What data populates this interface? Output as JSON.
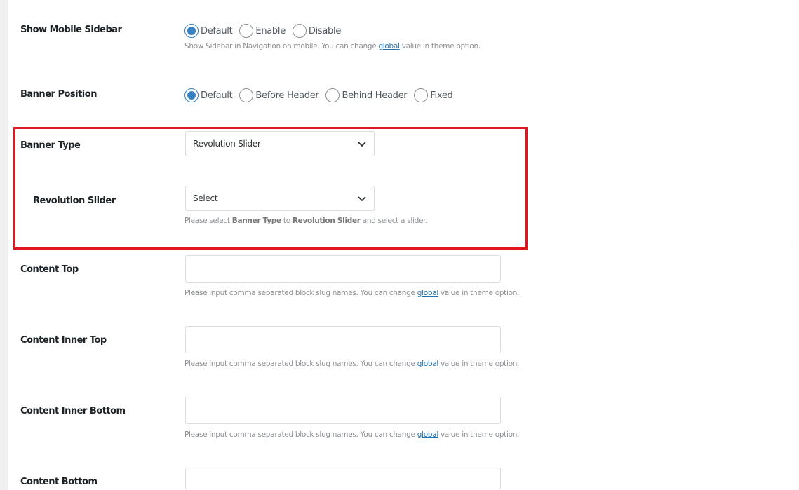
{
  "show_mobile_sidebar": {
    "label": "Show Mobile Sidebar",
    "options": [
      "Default",
      "Enable",
      "Disable"
    ],
    "selected": "Default",
    "description": {
      "before": "Show Sidebar in Navigation on mobile. You can change ",
      "link": "global",
      "after": " value in theme option."
    }
  },
  "banner_position": {
    "label": "Banner Position",
    "options": [
      "Default",
      "Before Header",
      "Behind Header",
      "Fixed"
    ],
    "selected": "Default"
  },
  "banner_type": {
    "label": "Banner Type",
    "value": "Revolution Slider"
  },
  "revolution_slider": {
    "label": "Revolution Slider",
    "value": "Select",
    "description": {
      "p1": "Please select ",
      "b1": "Banner Type",
      "p2": " to ",
      "b2": "Revolution Slider",
      "p3": " and select a slider."
    }
  },
  "block_description": {
    "before": "Please input comma separated block slug names. You can change ",
    "link": "global",
    "after": " value in theme option."
  },
  "content_top": {
    "label": "Content Top",
    "value": ""
  },
  "content_inner_top": {
    "label": "Content Inner Top",
    "value": ""
  },
  "content_inner_bottom": {
    "label": "Content Inner Bottom",
    "value": ""
  },
  "content_bottom": {
    "label": "Content Bottom",
    "value": ""
  },
  "colors": {
    "accent": "#3582c4",
    "highlight_border": "#e0161f",
    "link": "#2271b1"
  }
}
